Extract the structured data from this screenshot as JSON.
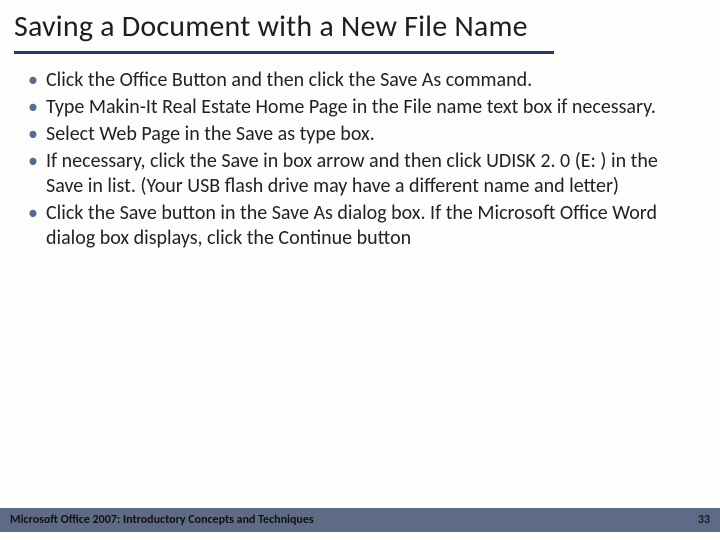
{
  "title": "Saving a Document with a New File Name",
  "bullets": [
    "Click the Office Button and then click the Save As command.",
    "Type Makin-It Real Estate Home Page in the File name text box if necessary.",
    "Select Web Page in the Save as type box.",
    "If necessary, click the Save in box arrow and then click UDISK 2. 0 (E: ) in the Save in list. (Your USB flash drive may have a different name and letter)",
    "Click the Save button in the Save As dialog box. If the Microsoft Office Word dialog box displays, click the Continue button"
  ],
  "footer": {
    "text": "Microsoft Office 2007: Introductory Concepts and Techniques",
    "page": "33"
  }
}
